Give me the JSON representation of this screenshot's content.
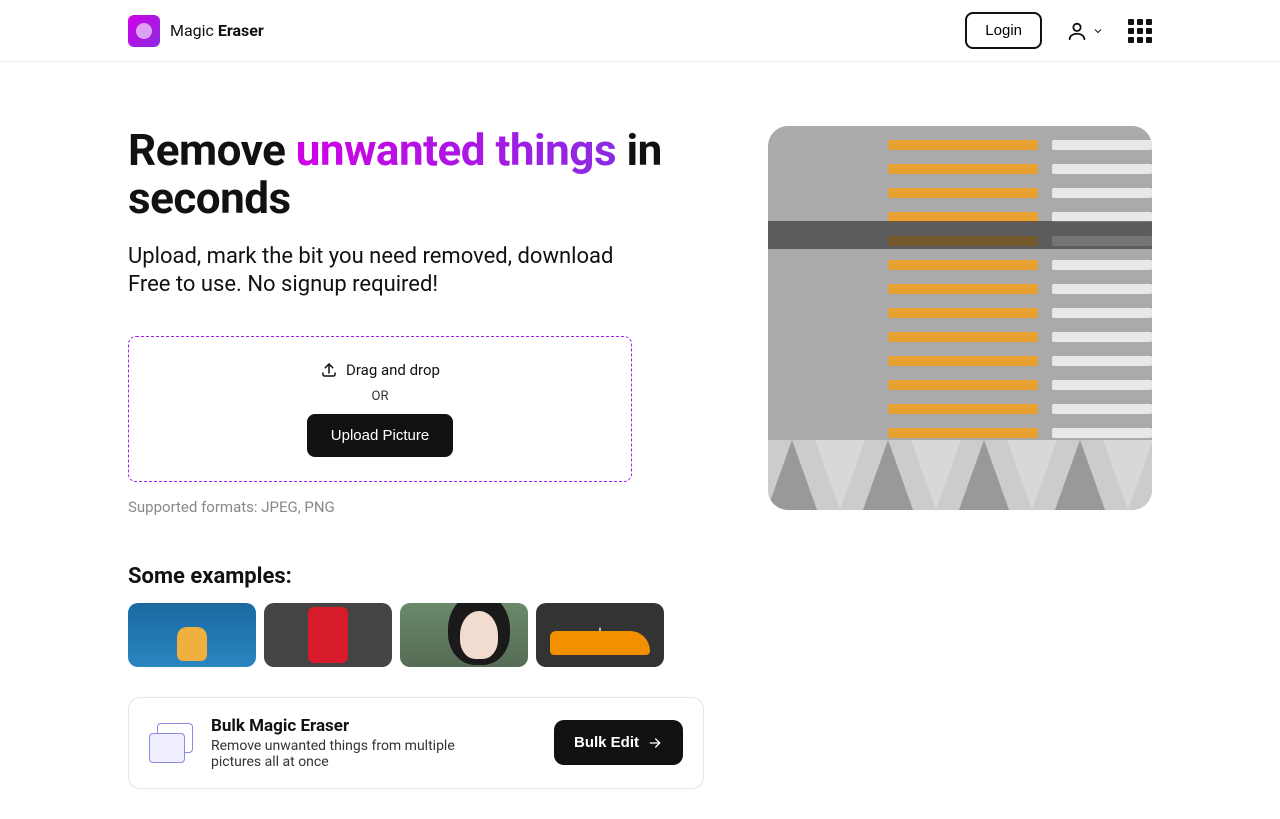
{
  "header": {
    "logo_prefix": "Magic ",
    "logo_bold": "Eraser",
    "login_label": "Login"
  },
  "hero": {
    "heading_before": "Remove ",
    "heading_highlight": "unwanted things",
    "heading_after": " in seconds",
    "subtitle_line1": "Upload, mark the bit you need removed, download",
    "subtitle_line2": "Free to use. No signup required!"
  },
  "dropzone": {
    "drag_label": "Drag and drop",
    "or_label": "OR",
    "upload_label": "Upload Picture"
  },
  "formats_label": "Supported formats: JPEG, PNG",
  "examples_heading": "Some examples:",
  "bulk": {
    "title": "Bulk Magic Eraser",
    "desc": "Remove unwanted things from multiple pictures all at once",
    "button_label": "Bulk Edit"
  }
}
